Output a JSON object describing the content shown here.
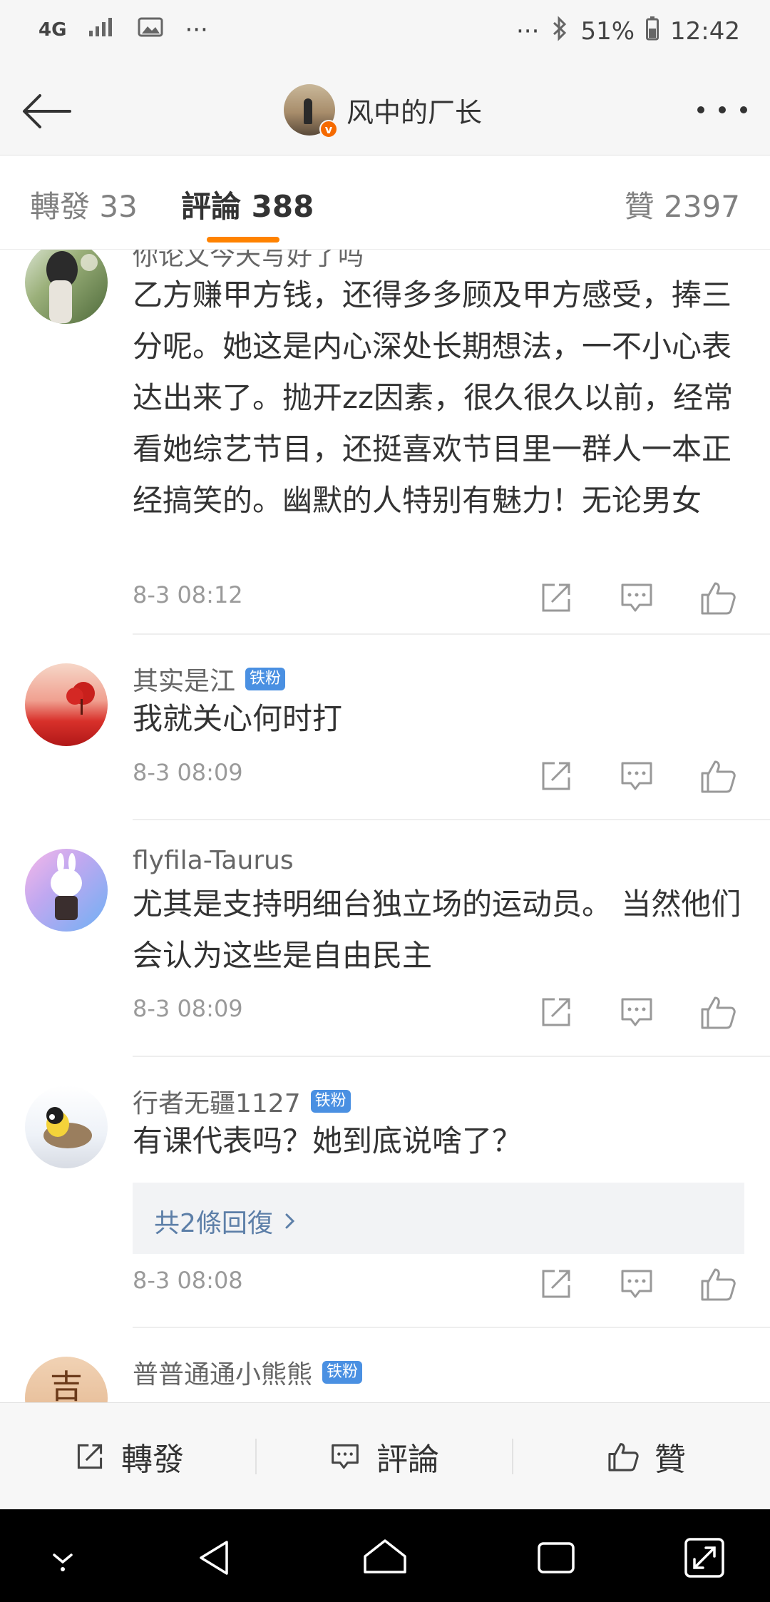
{
  "status_bar": {
    "network": "4G",
    "more": "···",
    "more_right": "···",
    "battery": "51%",
    "time": "12:42"
  },
  "header": {
    "title": "风中的厂长",
    "verified_badge": "v"
  },
  "tabs": {
    "repost": "轉發 33",
    "comment": "評論 388",
    "like": "贊 2397"
  },
  "comments": [
    {
      "name": "你论文今天写好了吗",
      "badge": "",
      "text": "乙方赚甲方钱，还得多多顾及甲方感受，捧三分呢。她这是内心深处长期想法，一不小心表达出来了。抛开zz因素，很久很久以前，经常看她综艺节目，还挺喜欢节目里一群人一本正经搞笑的。幽默的人特别有魅力！无论男女",
      "time": "8-3 08:12"
    },
    {
      "name": "其实是江",
      "badge": "铁粉",
      "text": "我就关心何时打",
      "time": "8-3 08:09"
    },
    {
      "name": "flyfila-Taurus",
      "badge": "",
      "text": "尤其是支持明细台独立场的运动员。 当然他们会认为这些是自由民主",
      "time": "8-3 08:09"
    },
    {
      "name": "行者无疆1127",
      "badge": "铁粉",
      "text": "有课代表吗？她到底说啥了？",
      "replies": "共2條回復",
      "time": "8-3 08:08"
    },
    {
      "name": "普普通通小熊熊",
      "badge": "铁粉"
    }
  ],
  "bottom_bar": {
    "repost": "轉發",
    "comment": "評論",
    "like": "贊"
  },
  "colors": {
    "accent": "#ff8200",
    "fan_badge": "#4a90e2",
    "link": "#5d7fa8"
  }
}
